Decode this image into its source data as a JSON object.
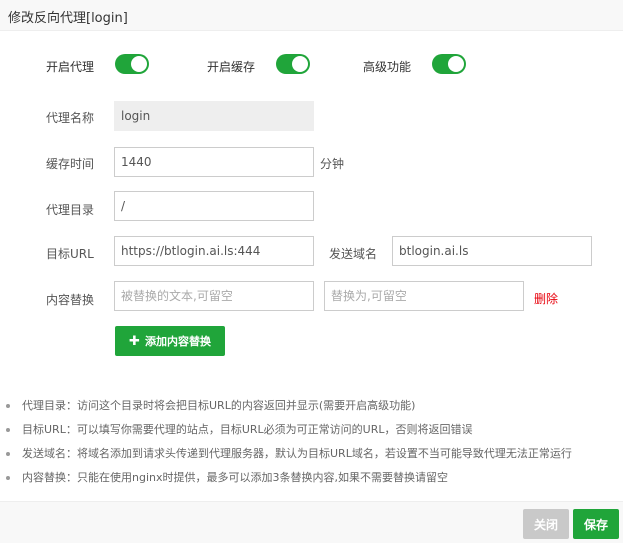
{
  "dialog": {
    "title": "修改反向代理[login]"
  },
  "switches": [
    {
      "label": "开启代理",
      "on": true
    },
    {
      "label": "开启缓存",
      "on": true
    },
    {
      "label": "高级功能",
      "on": true
    }
  ],
  "form": {
    "proxy_name": {
      "label": "代理名称",
      "value": "login"
    },
    "cache_time": {
      "label": "缓存时间",
      "value": "1440",
      "unit": "分钟"
    },
    "proxy_dir": {
      "label": "代理目录",
      "value": "/"
    },
    "target_url": {
      "label": "目标URL",
      "value": "https://btlogin.ai.ls:444"
    },
    "send_domain": {
      "label": "发送域名",
      "value": "btlogin.ai.ls"
    },
    "content_replace": {
      "label": "内容替换",
      "from_placeholder": "被替换的文本,可留空",
      "to_placeholder": "替换为,可留空",
      "delete_label": "删除"
    },
    "add_replace_label": "添加内容替换"
  },
  "notes": [
    "代理目录：访问这个目录时将会把目标URL的内容返回并显示(需要开启高级功能)",
    "目标URL：可以填写你需要代理的站点，目标URL必须为可正常访问的URL，否则将返回错误",
    "发送域名：将域名添加到请求头传递到代理服务器，默认为目标URL域名，若设置不当可能导致代理无法正常运行",
    "内容替换：只能在使用nginx时提供，最多可以添加3条替换内容,如果不需要替换请留空"
  ],
  "footer": {
    "close_label": "关闭",
    "save_label": "保存"
  },
  "colors": {
    "accent": "#20a53a",
    "danger": "#e8000b",
    "disabled": "#c9c9c9"
  }
}
